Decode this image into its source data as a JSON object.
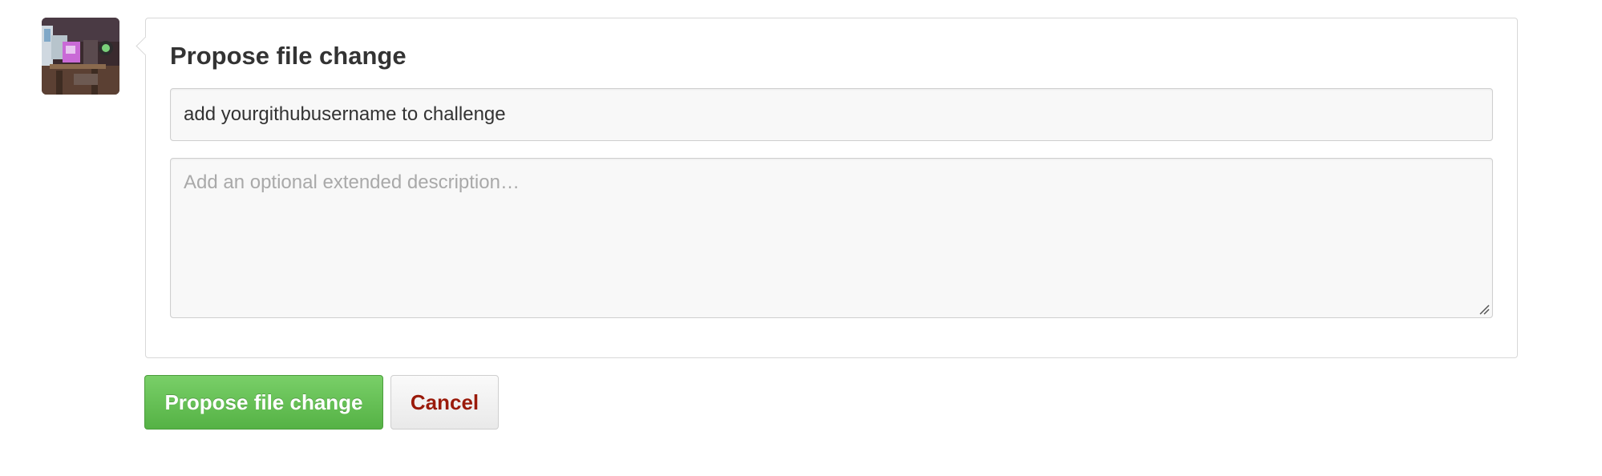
{
  "avatar": {
    "icon": "avatar-photo"
  },
  "panel": {
    "title": "Propose file change"
  },
  "form": {
    "summary_value": "add yourgithubusername to challenge",
    "description_placeholder": "Add an optional extended description…",
    "description_value": ""
  },
  "actions": {
    "submit_label": "Propose file change",
    "cancel_label": "Cancel"
  },
  "colors": {
    "submit_green": "#5ebd4f",
    "cancel_text": "#9a1a0a",
    "title_text": "#333333"
  }
}
